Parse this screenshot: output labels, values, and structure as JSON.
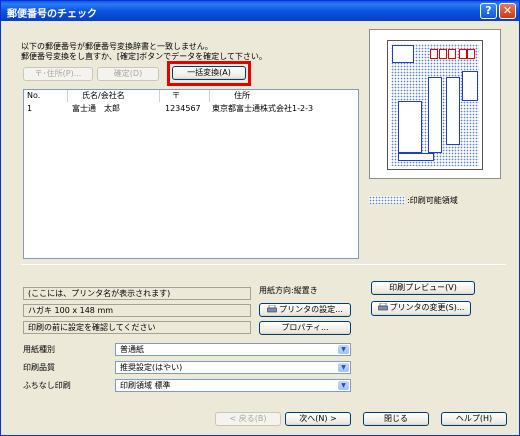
{
  "window": {
    "title": "郵便番号のチェック",
    "help_label": "?",
    "close_label": "✕"
  },
  "message": {
    "line1": "以下の郵便番号が郵便番号変換辞書と一致しません。",
    "line2": "郵便番号変換をし直すか、[確定]ボタンでデータを確定して下さい。"
  },
  "toolbar": {
    "address_button": "〒･住所(P)...",
    "confirm_button": "確定(D)",
    "bulk_convert_button": "一括変換(A)"
  },
  "table": {
    "columns": [
      "No.",
      "氏名/会社名",
      "〒",
      "住所"
    ],
    "rows": [
      [
        "1",
        "富士通　太郎",
        "1234567",
        "東京都富士通株式会社1-2-3"
      ]
    ]
  },
  "preview": {
    "legend_label": ":印刷可能領域",
    "print_preview_button": "印刷プレビュー(V)"
  },
  "printer": {
    "printer_name": "(ここには、プリンタ名が表示されます)",
    "paper_orientation": "用紙方向:縦置き",
    "paper_size": "ハガキ 100 x 148 mm",
    "notice": "印刷の前に設定を確認してください",
    "printer_settings_button": "プリンタの設定...",
    "change_printer_button": "プリンタの変更(S)...",
    "properties_button": "プロパティ..."
  },
  "options": {
    "paper_type_label": "用紙種別",
    "paper_type_value": "普通紙",
    "print_quality_label": "印刷品質",
    "print_quality_value": "推奨設定(はやい)",
    "borderless_label": "ふちなし印刷",
    "borderless_value": "印刷領域 標準"
  },
  "footer": {
    "back_button": "< 戻る(B)",
    "next_button": "次へ(N) >",
    "close_button": "閉じる",
    "help_button": "ヘルプ(H)"
  },
  "colors": {
    "title_bar": "#0a5ce9",
    "highlight": "#e00000",
    "dialog_bg": "#ece9d8"
  }
}
